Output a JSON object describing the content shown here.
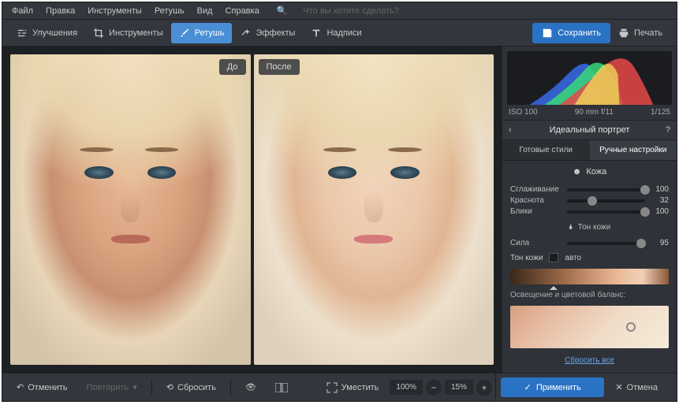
{
  "menu": {
    "file": "Файл",
    "edit": "Правка",
    "tools": "Инструменты",
    "retouch": "Ретушь",
    "view": "Вид",
    "help": "Справка",
    "search_placeholder": "Что вы хотите сделать?"
  },
  "tabs": {
    "enhance": "Улучшения",
    "tools": "Инструменты",
    "retouch": "Ретушь",
    "effects": "Эффекты",
    "text": "Надписи"
  },
  "actions": {
    "save": "Сохранить",
    "print": "Печать"
  },
  "compare": {
    "before": "До",
    "after": "После"
  },
  "meta": {
    "iso": "ISO 100",
    "focal": "90 mm f/11",
    "shutter": "1/125"
  },
  "panel": {
    "title": "Идеальный портрет",
    "tab_presets": "Готовые стили",
    "tab_manual": "Ручные настройки",
    "section_skin": "Кожа",
    "section_tone": "Тон кожи",
    "section_light": "Освещение и цветовой баланс:",
    "reset": "Сбросить все"
  },
  "sliders": {
    "smoothing": {
      "label": "Сглаживание",
      "value": 100,
      "pos": 100
    },
    "redness": {
      "label": "Краснота",
      "value": 32,
      "pos": 32
    },
    "glare": {
      "label": "Блики",
      "value": 100,
      "pos": 100
    },
    "strength": {
      "label": "Сила",
      "value": 95,
      "pos": 95
    }
  },
  "tone": {
    "label": "Тон кожи",
    "auto": "авто"
  },
  "bottom": {
    "undo": "Отменить",
    "redo": "Повторить",
    "reset": "Сбросить",
    "fit": "Уместить",
    "zoom1": "100%",
    "zoom2": "15%",
    "apply": "Применить",
    "cancel": "Отмена"
  }
}
